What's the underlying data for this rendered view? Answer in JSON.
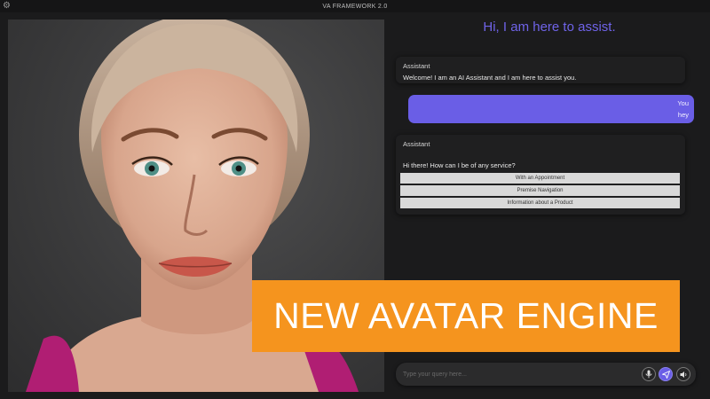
{
  "window": {
    "title": "VA FRAMEWORK 2.0",
    "settings_icon": "gear-icon"
  },
  "avatar": {
    "description_icon": "avatar-woman",
    "background_color": "#3d3d3e"
  },
  "chat": {
    "header": "Hi, I am here to assist.",
    "messages": [
      {
        "sender": "Assistant",
        "text": "Welcome! I am an AI Assistant and I am here to assist you."
      },
      {
        "sender": "You",
        "text": "hey"
      },
      {
        "sender": "Assistant",
        "text": "Hi there! How can I be of any service?"
      }
    ],
    "options": [
      "With an Appointment",
      "Premise Navigation",
      "Information about a Product"
    ]
  },
  "input": {
    "placeholder": "Type your query here...",
    "mic_icon": "microphone-icon",
    "send_icon": "send-icon",
    "speaker_icon": "speaker-icon"
  },
  "banner": {
    "text": "NEW AVATAR ENGINE"
  },
  "colors": {
    "accent": "#6a5ee6",
    "banner": "#f5941e",
    "background": "#1b1b1c"
  }
}
